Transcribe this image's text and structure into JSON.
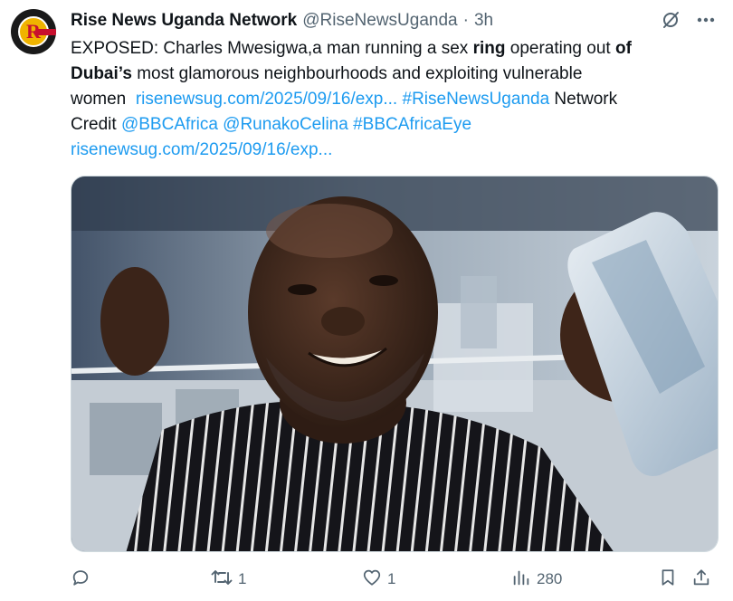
{
  "account": {
    "name": "Rise News Uganda Network",
    "handle": "@RiseNewsUganda",
    "separator": "·",
    "time": "3h"
  },
  "tweet": {
    "line1_pre": "EXPOSED: Charles Mwesigwa,a man running a sex ",
    "line1_bold1": "ring",
    "line1_mid": " operating out ",
    "line1_bold2": "of",
    "line2_bold": "Dubai’s",
    "line2_rest": " most glamorous neighbourhoods and exploiting vulnerable",
    "line3_pre": "women  ",
    "link1": "risenewsug.com/2025/09/16/exp...",
    "hashtag1": "#RiseNewsUganda",
    "line3_post": " Network",
    "line4_pre": "Credit ",
    "mention1": "@BBCAfrica",
    "mention2": "@RunakoCelina",
    "hashtag2": "#BBCAfricaEye",
    "link2": "risenewsug.com/2025/09/16/exp..."
  },
  "actions": {
    "replies": "",
    "reposts": "1",
    "likes": "1",
    "views": "280"
  },
  "icons": {
    "header": [
      "grok-slash-icon",
      "more-icon"
    ],
    "bar": [
      "reply-icon",
      "repost-icon",
      "like-icon",
      "views-icon",
      "bookmark-icon",
      "share-icon"
    ]
  },
  "colors": {
    "link": "#1d9bf0",
    "secondary_text": "#536471",
    "text": "#0f1419"
  }
}
